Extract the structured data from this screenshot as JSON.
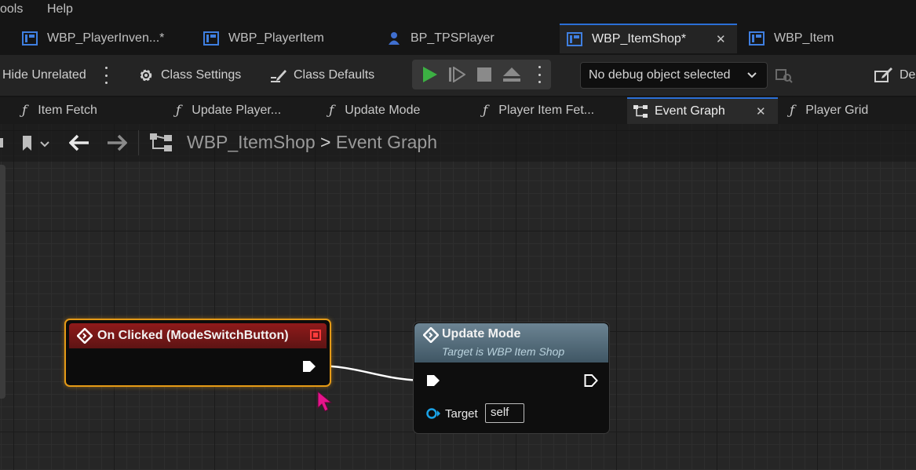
{
  "menu": {
    "items": [
      "ools",
      "Help"
    ]
  },
  "document_tabs": [
    {
      "label": "WBP_PlayerInven...*",
      "icon": "widget-blueprint-icon",
      "active": false
    },
    {
      "label": "WBP_PlayerItem",
      "icon": "widget-blueprint-icon",
      "active": false
    },
    {
      "label": "BP_TPSPlayer",
      "icon": "character-blueprint-icon",
      "active": false
    },
    {
      "label": "WBP_ItemShop*",
      "icon": "widget-blueprint-icon",
      "active": true
    },
    {
      "label": "WBP_Item",
      "icon": "widget-blueprint-icon",
      "active": false
    }
  ],
  "toolbar": {
    "hide_unrelated": "Hide Unrelated",
    "class_settings": "Class Settings",
    "class_defaults": "Class Defaults",
    "debug_object": "No debug object selected",
    "truncated_right": "Des"
  },
  "function_tabs": [
    {
      "label": "Item Fetch",
      "icon": "function-icon"
    },
    {
      "label": "Update Player...",
      "icon": "function-icon"
    },
    {
      "label": "Update Mode",
      "icon": "function-icon"
    },
    {
      "label": "Player Item Fet...",
      "icon": "function-icon"
    },
    {
      "label": "Event Graph",
      "icon": "event-graph-icon",
      "active": true
    },
    {
      "label": "Player Grid",
      "icon": "function-icon"
    }
  ],
  "breadcrumb": {
    "blueprint": "WBP_ItemShop",
    "separator": ">",
    "graph": "Event Graph"
  },
  "nodes": {
    "event": {
      "title": "On Clicked (ModeSwitchButton)"
    },
    "function": {
      "title": "Update Mode",
      "subtitle": "Target is WBP Item Shop",
      "target_label": "Target",
      "target_value": "self"
    }
  },
  "colors": {
    "accent": "#2b6fd6",
    "event_header": "#8f1a1a",
    "selection": "#e59a16",
    "function_header": "#6c8493",
    "play": "#3cb043",
    "cursor": "#e6148c"
  }
}
